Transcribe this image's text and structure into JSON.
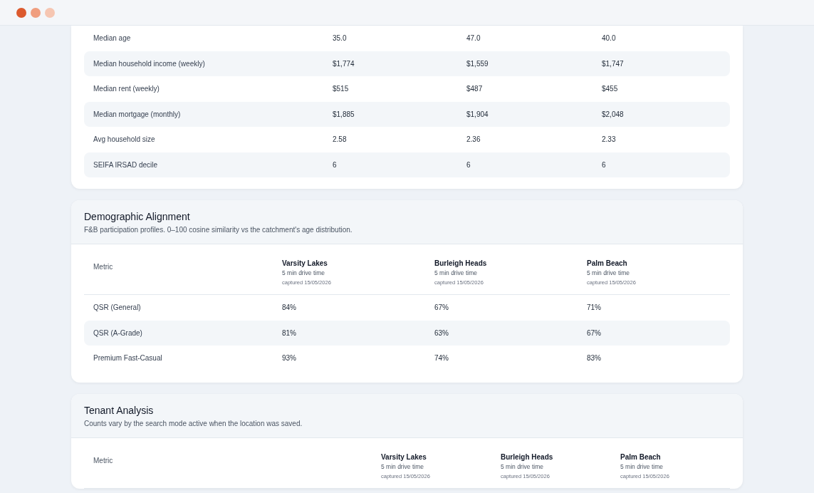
{
  "sections": [
    {
      "rows": [
        {
          "label": "Median age",
          "values": [
            "35.0",
            "47.0",
            "40.0"
          ]
        },
        {
          "label": "Median household income (weekly)",
          "values": [
            "$1,774",
            "$1,559",
            "$1,747"
          ]
        },
        {
          "label": "Median rent (weekly)",
          "values": [
            "$515",
            "$487",
            "$455"
          ]
        },
        {
          "label": "Median mortgage (monthly)",
          "values": [
            "$1,885",
            "$1,904",
            "$2,048"
          ]
        },
        {
          "label": "Avg household size",
          "values": [
            "2.58",
            "2.36",
            "2.33"
          ]
        },
        {
          "label": "SEIFA IRSAD decile",
          "values": [
            "6",
            "6",
            "6"
          ]
        }
      ]
    },
    {
      "title": "Demographic Alignment",
      "subtitle": "F&B participation profiles. 0–100 cosine similarity vs the catchment's age distribution.",
      "metric_label": "Metric",
      "columns": [
        {
          "name": "Varsity Lakes",
          "drive": "5 min drive time",
          "captured": "captured 15/05/2026"
        },
        {
          "name": "Burleigh Heads",
          "drive": "5 min drive time",
          "captured": "captured 15/05/2026"
        },
        {
          "name": "Palm Beach",
          "drive": "5 min drive time",
          "captured": "captured 15/05/2026"
        }
      ],
      "rows": [
        {
          "label": "QSR (General)",
          "values": [
            "84%",
            "67%",
            "71%"
          ]
        },
        {
          "label": "QSR (A-Grade)",
          "values": [
            "81%",
            "63%",
            "67%"
          ]
        },
        {
          "label": "Premium Fast-Casual",
          "values": [
            "93%",
            "74%",
            "83%"
          ]
        }
      ]
    },
    {
      "title": "Tenant Analysis",
      "subtitle": "Counts vary by the search mode active when the location was saved.",
      "metric_label": "Metric",
      "columns": [
        {
          "name": "Varsity Lakes",
          "drive": "5 min drive time",
          "captured": "captured 15/05/2026"
        },
        {
          "name": "Burleigh Heads",
          "drive": "5 min drive time",
          "captured": "captured 15/05/2026"
        },
        {
          "name": "Palm Beach",
          "drive": "5 min drive time",
          "captured": "captured 15/05/2026"
        }
      ]
    }
  ]
}
